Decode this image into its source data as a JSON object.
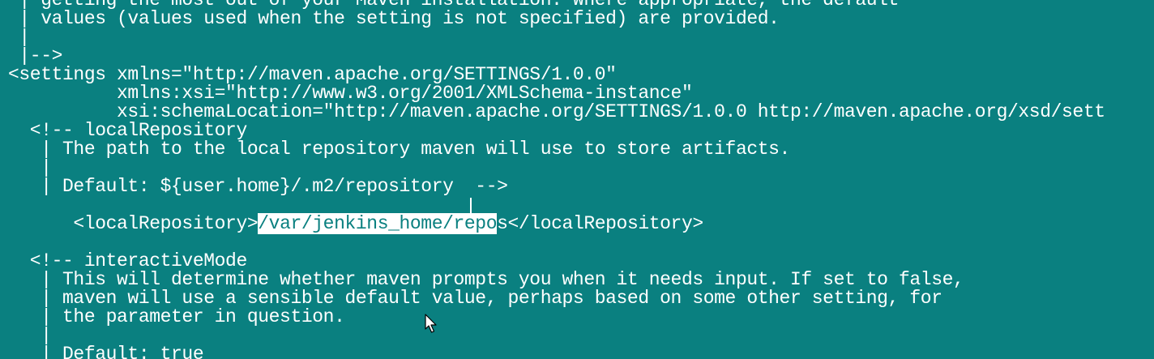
{
  "colors": {
    "background": "#0a8080",
    "text": "#ffffff",
    "selection_background": "#ffffff",
    "selection_text": "#0a8080"
  },
  "terminal": {
    "lines": [
      " | getting the most out of your Maven installation. Where appropriate, the default",
      " | values (values used when the setting is not specified) are provided.",
      " |",
      " |-->",
      "<settings xmlns=\"http://maven.apache.org/SETTINGS/1.0.0\"",
      "          xmlns:xsi=\"http://www.w3.org/2001/XMLSchema-instance\"",
      "          xsi:schemaLocation=\"http://maven.apache.org/SETTINGS/1.0.0 http://maven.apache.org/xsd/sett",
      "  <!-- localRepository",
      "   | The path to the local repository maven will use to store artifacts.",
      "   |",
      "   | Default: ${user.home}/.m2/repository  -->",
      "",
      "",
      "",
      "  <!-- interactiveMode",
      "   | This will determine whether maven prompts you when it needs input. If set to false,",
      "   | maven will use a sensible default value, perhaps based on some other setting, for",
      "   | the parameter in question.",
      "   |",
      "   | Default: true"
    ],
    "local_repo_line": {
      "prefix": "  <localRepository>",
      "selected": "/var/jenkins_home/repo",
      "after_selection": "s</localRepository>"
    },
    "mouse_icon": "arrow-pointer-icon",
    "cursor_icon": "text-cursor-icon"
  }
}
